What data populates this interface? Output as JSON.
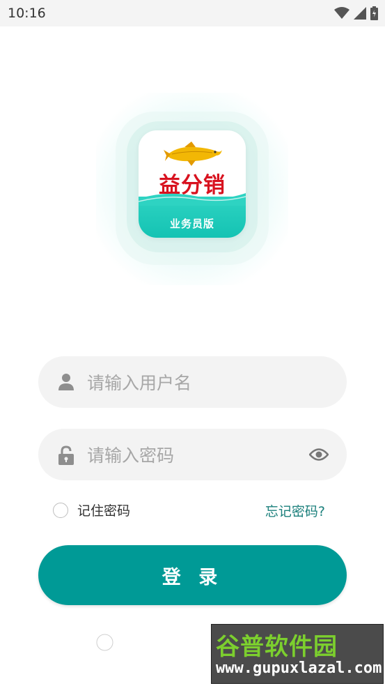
{
  "status_bar": {
    "time": "10:16",
    "icons": [
      "wifi-icon",
      "signal-icon",
      "battery-icon"
    ]
  },
  "logo": {
    "brand": "益分销",
    "subtitle": "业务员版",
    "colors": {
      "brand_red": "#d8121f",
      "teal": "#14c3b3"
    }
  },
  "form": {
    "username": {
      "placeholder": "请输入用户名",
      "value": "",
      "icon": "user-icon"
    },
    "password": {
      "placeholder": "请输入密码",
      "value": "",
      "icon": "lock-icon",
      "toggle_icon": "eye-icon"
    },
    "remember_label": "记住密码",
    "remember_checked": false,
    "forgot_label": "忘记密码?",
    "login_label": "登 录"
  },
  "colors": {
    "accent": "#009a96",
    "link": "#1a7f7b",
    "field_bg": "#f3f3f3"
  },
  "watermark": {
    "title": "谷普软件园",
    "url": "www.gupuxlazal.com"
  }
}
